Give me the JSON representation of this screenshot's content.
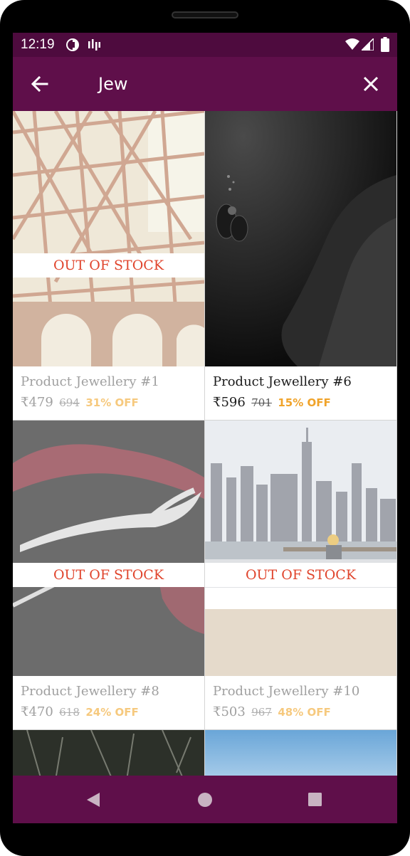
{
  "status_bar": {
    "time": "12:19",
    "icons": [
      "notification-icon",
      "sim-icon",
      "wifi-icon",
      "cell-signal-icon",
      "battery-icon"
    ]
  },
  "app_bar": {
    "search_query": "Jew",
    "back_icon": "arrow-back-icon",
    "close_icon": "close-icon"
  },
  "products": [
    {
      "name": "Product Jewellery #1",
      "price": "₹479",
      "mrp": "694",
      "discount": "31% OFF",
      "badge": "OUT OF STOCK"
    },
    {
      "name": "Product Jewellery #6",
      "price": "₹596",
      "mrp": "701",
      "discount": "15% OFF"
    },
    {
      "name": "Product Jewellery #8",
      "price": "₹470",
      "mrp": "618",
      "discount": "24% OFF",
      "badge": "OUT OF STOCK"
    },
    {
      "name": "Product Jewellery #10",
      "price": "₹503",
      "mrp": "967",
      "discount": "48% OFF",
      "badge": "OUT OF STOCK"
    }
  ],
  "nav_bar": {
    "icons": [
      "triangle-back-icon",
      "circle-home-icon",
      "square-recents-icon"
    ]
  },
  "colors": {
    "status_bar": "#4e0b3e",
    "app_bar": "#5f0f4a",
    "out_of_stock": "#e0442c",
    "discount": "#f0a32a"
  }
}
